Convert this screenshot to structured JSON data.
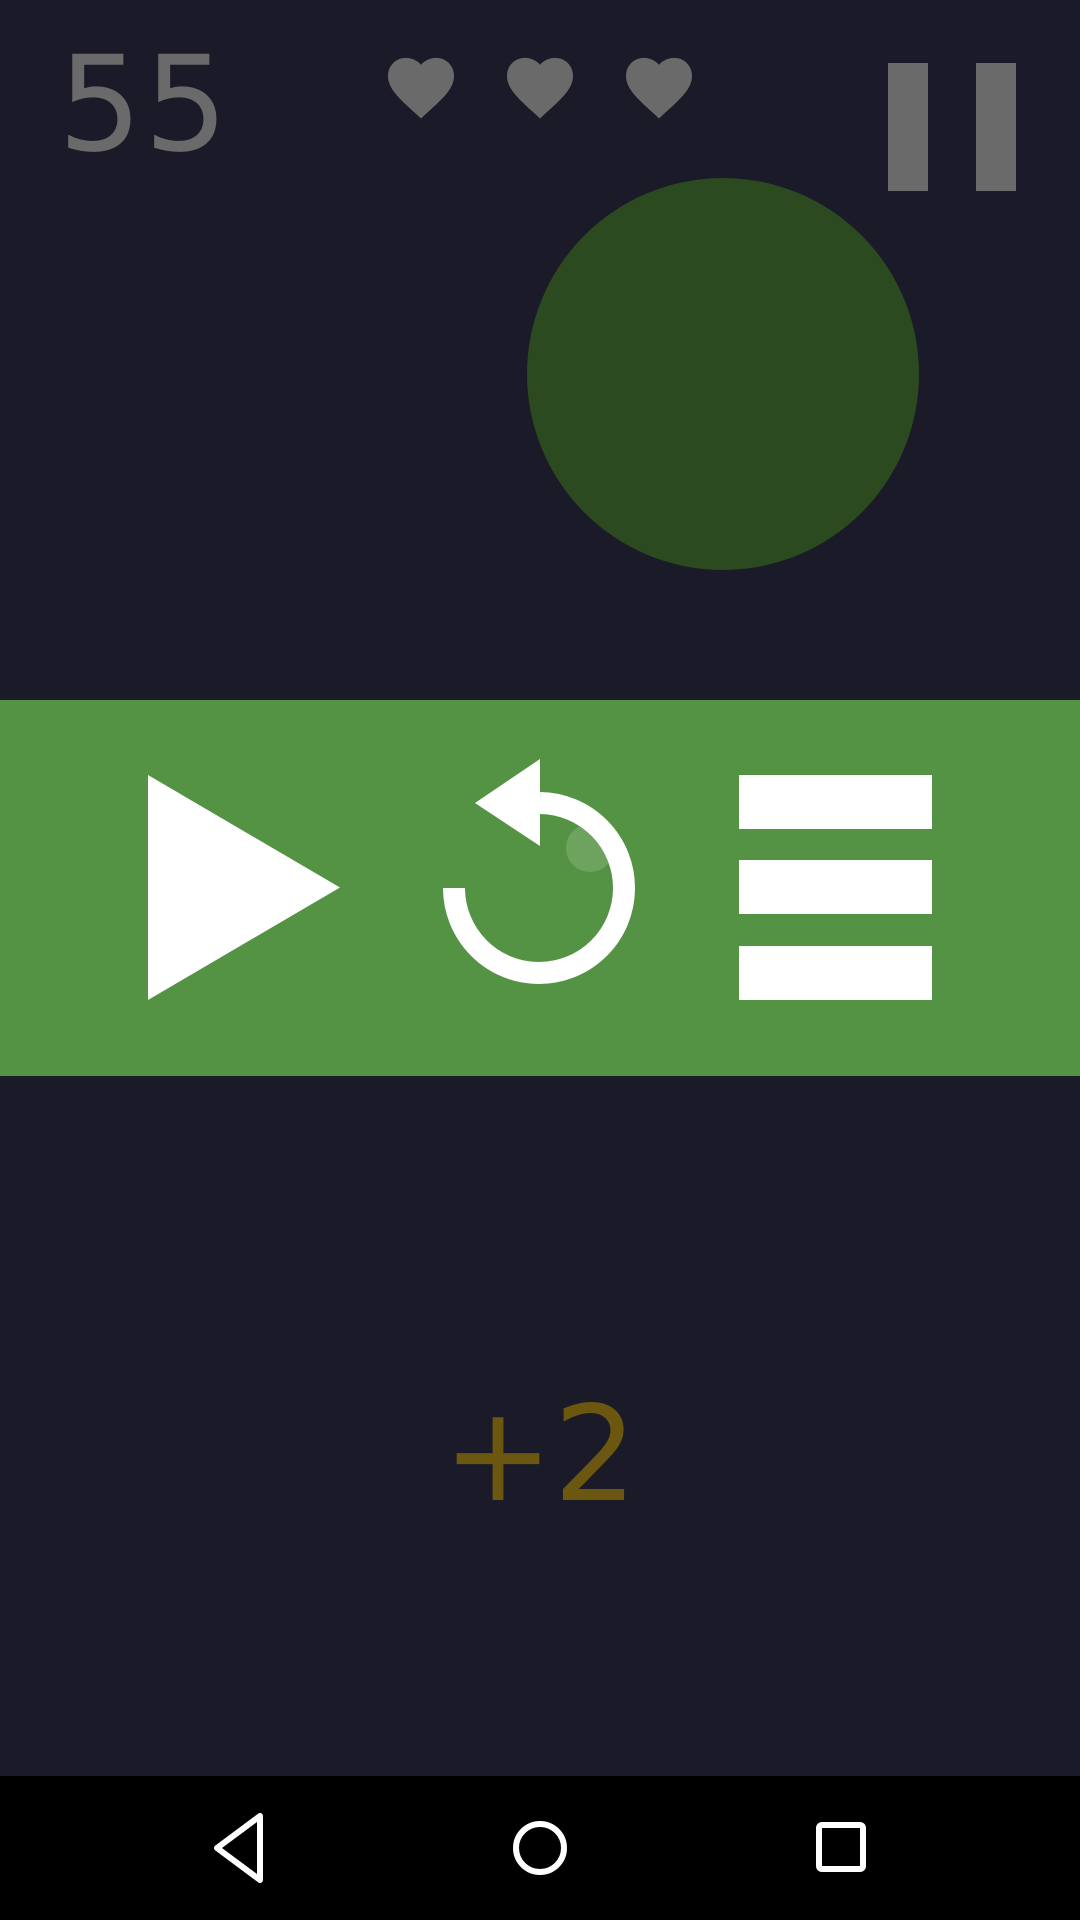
{
  "hud": {
    "score": "55",
    "lives": 3,
    "lives_total": 3,
    "pause_icon": "pause-icon",
    "heart_icon": "heart-icon"
  },
  "target": {
    "shape": "circle",
    "color": "#2b4a20"
  },
  "menu": {
    "background": "#559344",
    "buttons": [
      {
        "name": "resume",
        "icon": "play-icon"
      },
      {
        "name": "restart",
        "icon": "restart-icon"
      },
      {
        "name": "menu",
        "icon": "menu-icon"
      }
    ]
  },
  "bonus": {
    "text": "+2",
    "color": "#6b5710"
  },
  "navbar": {
    "buttons": [
      {
        "name": "back",
        "icon": "back-triangle-icon"
      },
      {
        "name": "home",
        "icon": "home-circle-icon"
      },
      {
        "name": "recents",
        "icon": "recents-square-icon"
      }
    ]
  },
  "colors": {
    "background": "#1b1a28",
    "hud_gray": "#6a6a6a",
    "white": "#ffffff",
    "navbar": "#000000"
  }
}
